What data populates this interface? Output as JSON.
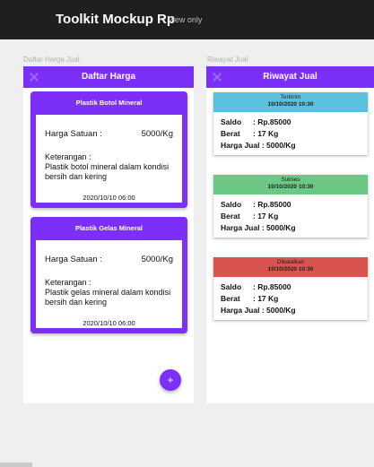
{
  "header": {
    "title": "Toolkit Mockup Rp",
    "view_mode": "View only"
  },
  "frames": {
    "left_label": "Daftar Harga Jual",
    "right_label": "Riwayat Jual"
  },
  "left_panel": {
    "title": "Daftar Harga",
    "cards": [
      {
        "title": "Plastik Botol  Mineral",
        "price_label": "Harga Satuan :",
        "price_value": "5000/Kg",
        "desc_label": "Keterangan :",
        "desc": "Plastik botol mineral dalam kondisi bersih dan kering",
        "date": "2020/10/10  06:00"
      },
      {
        "title": "Plastik Gelas Mineral",
        "price_label": "Harga Satuan :",
        "price_value": "5000/Kg",
        "desc_label": "Keterangan :",
        "desc": "Plastik gelas mineral dalam kondisi bersih dan kering",
        "date": "2020/10/10  06:00"
      }
    ],
    "fab_label": "+"
  },
  "right_panel": {
    "title": "Riwayat Jual",
    "entries": [
      {
        "status": "Terkirim",
        "time": "10/10/2020 10:30",
        "color": "#5bc0de",
        "saldo_label": "Saldo",
        "saldo": ": Rp.85000",
        "berat_label": "Berat",
        "berat": ": 17 Kg",
        "harga": "Harga Jual : 5000/Kg"
      },
      {
        "status": "Sukses",
        "time": "10/10/2020 10:30",
        "color": "#6cc785",
        "saldo_label": "Saldo",
        "saldo": ": Rp.85000",
        "berat_label": "Berat",
        "berat": ": 17 Kg",
        "harga": "Harga Jual : 5000/Kg"
      },
      {
        "status": "Dibatalkan",
        "time": "10/10/2020 10:30",
        "color": "#d9534f",
        "saldo_label": "Saldo",
        "saldo": ": Rp.85000",
        "berat_label": "Berat",
        "berat": ": 17 Kg",
        "harga": "Harga Jual : 5000/Kg"
      }
    ]
  },
  "colors": {
    "accent": "#7b2ff7",
    "topbar": "#1f1f1f",
    "background": "#efefef"
  }
}
